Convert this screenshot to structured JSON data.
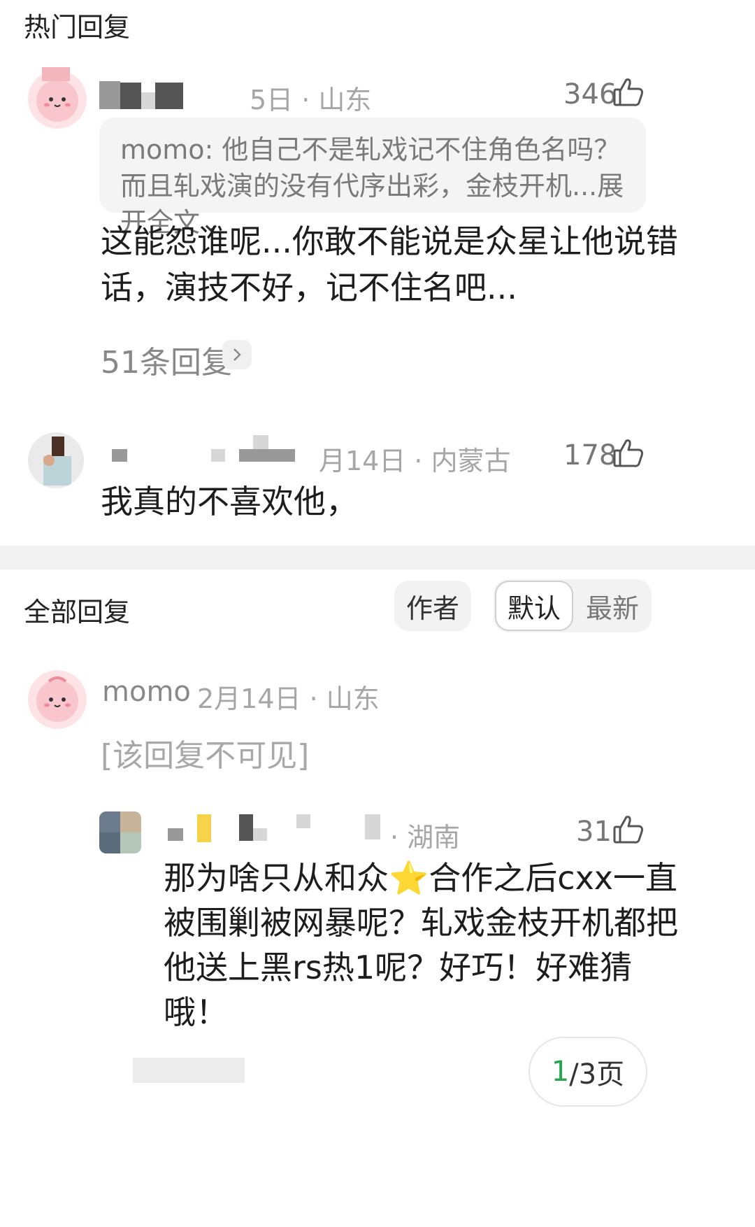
{
  "hot_section": {
    "title": "热门回复"
  },
  "hot_comments": [
    {
      "meta": "5日 · 山东",
      "likes": "346",
      "quote": "momo: 他自己不是轧戏记不住角色名吗？而且轧戏演的没有代序出彩，金枝开机...展开全文",
      "text_line1": "这能怨谁呢...你敢不能说是众星让他说错",
      "text_line2": "话，演技不好，记不住名吧...",
      "replies_label": "51条回复"
    },
    {
      "meta": "月14日 · 内蒙古",
      "likes": "178",
      "text": "我真的不喜欢他，"
    }
  ],
  "all_section": {
    "title": "全部回复",
    "filters": {
      "author": "作者",
      "default": "默认",
      "latest": "最新"
    }
  },
  "all_comments": [
    {
      "username": "momo",
      "meta": "2月14日 · 山东",
      "hidden_text": "[该回复不可见]"
    }
  ],
  "nested_reply": {
    "meta": "· 湖南",
    "likes": "31",
    "line1": "那为啥只从和众⭐合作之后cxx一直",
    "line2": "被围剿被网暴呢？轧戏金枝开机都把",
    "line3": "他送上黑rs热1呢？好巧！好难猜",
    "line4": "哦！"
  },
  "pagination": {
    "current": "1",
    "label": "/3页"
  },
  "colors": {
    "accent_green": "#2aa44f",
    "meta_gray": "#a6a6a6"
  },
  "icons": [
    "thumbs-up-icon",
    "chevron-down-icon",
    "chevron-right-icon",
    "avatar"
  ]
}
